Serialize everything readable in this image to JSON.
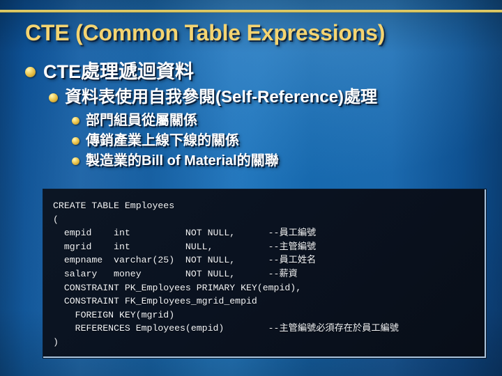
{
  "slide": {
    "title": "CTE (Common Table Expressions)",
    "accent_gold": "#f4d471",
    "background_blue": "#1568af",
    "code_background": "#0a1220"
  },
  "bullets": {
    "level1": [
      {
        "text": "CTE處理遞迴資料"
      }
    ],
    "level2": [
      {
        "text": "資料表使用自我參閱(Self-Reference)處理"
      }
    ],
    "level3": [
      {
        "text": "部門組員從屬關係"
      },
      {
        "text": "傳銷產業上線下線的關係"
      },
      {
        "text": "製造業的Bill of Material的關聯"
      }
    ]
  },
  "code_block": {
    "language": "sql",
    "lines": [
      "CREATE TABLE Employees",
      "(",
      "  empid    int          NOT NULL,      --員工編號",
      "  mgrid    int          NULL,          --主管編號",
      "  empname  varchar(25)  NOT NULL,      --員工姓名",
      "  salary   money        NOT NULL,      --薪資",
      "  CONSTRAINT PK_Employees PRIMARY KEY(empid),",
      "  CONSTRAINT FK_Employees_mgrid_empid",
      "    FOREIGN KEY(mgrid)",
      "    REFERENCES Employees(empid)        --主管編號必須存在於員工編號",
      ")"
    ]
  }
}
